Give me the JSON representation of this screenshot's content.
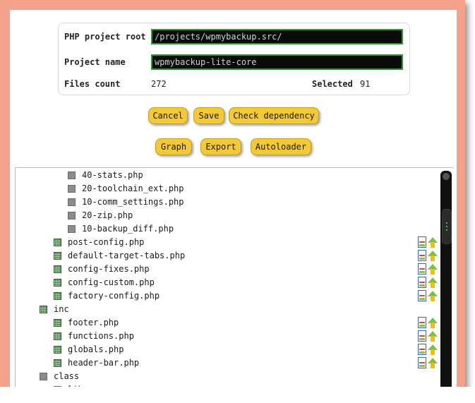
{
  "form": {
    "project_root_label": "PHP project root",
    "project_root_value": "/projects/wpmybackup.src/",
    "project_name_label": "Project name",
    "project_name_value": "wpmybackup-lite-core",
    "files_count_label": "Files count",
    "files_count_value": "272",
    "selected_label": "Selected",
    "selected_value": "91"
  },
  "buttons": {
    "cancel": "Cancel",
    "save": "Save",
    "check_dependency": "Check dependency",
    "graph": "Graph",
    "export": "Export",
    "autoloader": "Autoloader"
  },
  "tree": {
    "rows": [
      {
        "name": "40-stats.php",
        "checked": false,
        "actions": false
      },
      {
        "name": "20-toolchain_ext.php",
        "checked": false,
        "actions": false
      },
      {
        "name": "10-comm_settings.php",
        "checked": false,
        "actions": false
      },
      {
        "name": "20-zip.php",
        "checked": false,
        "actions": false
      },
      {
        "name": "10-backup_diff.php",
        "checked": false,
        "actions": false
      },
      {
        "name": "post-config.php",
        "checked": true,
        "actions": true
      },
      {
        "name": "default-target-tabs.php",
        "checked": true,
        "actions": true
      },
      {
        "name": "config-fixes.php",
        "checked": true,
        "actions": true
      },
      {
        "name": "config-custom.php",
        "checked": true,
        "actions": true
      },
      {
        "name": "factory-config.php",
        "checked": true,
        "actions": true
      },
      {
        "name": "inc",
        "checked": true,
        "actions": false
      },
      {
        "name": "footer.php",
        "checked": true,
        "actions": true
      },
      {
        "name": "functions.php",
        "checked": true,
        "actions": true
      },
      {
        "name": "globals.php",
        "checked": true,
        "actions": true
      },
      {
        "name": "header-bar.php",
        "checked": true,
        "actions": true
      },
      {
        "name": "class",
        "checked": false,
        "actions": false
      },
      {
        "name": "lib",
        "checked": false,
        "actions": false
      }
    ]
  },
  "colors": {
    "frame": "#f4a08a",
    "button": "#f2c93a",
    "field_bg": "#0a0a0a",
    "field_border": "#2f9a2f"
  }
}
